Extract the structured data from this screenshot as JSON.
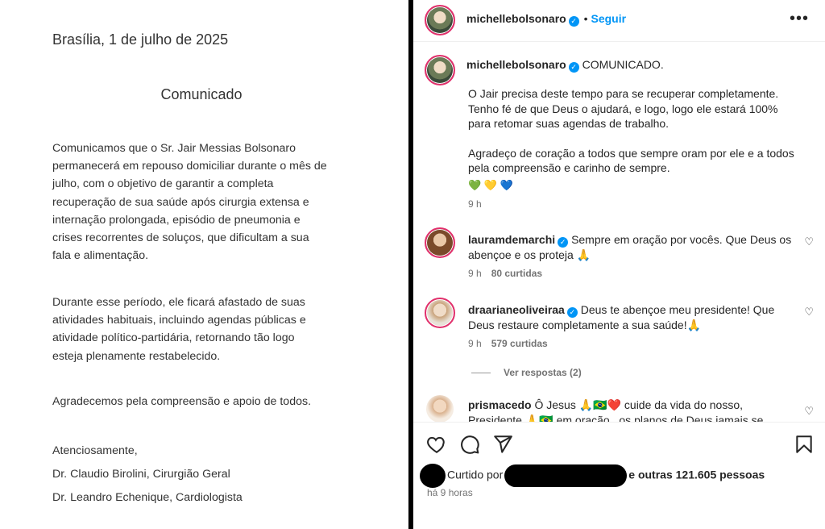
{
  "document": {
    "date": "Brasília, 1 de julho de 2025",
    "title": "Comunicado",
    "paragraph1": [
      "Comunicamos que o Sr. Jair Messias Bolsonaro",
      "permanecerá em repouso domiciliar durante o mês de",
      "julho, com o objetivo de garantir a completa",
      "recuperação de sua saúde após cirurgia extensa e",
      "internação prolongada, episódio de pneumonia e",
      "crises recorrentes de soluços, que dificultam a sua",
      "fala e alimentação."
    ],
    "paragraph2": [
      "Durante esse período, ele ficará afastado de suas",
      "atividades habituais, incluindo agendas públicas e",
      "atividade político-partidária, retornando tão logo",
      "esteja plenamente restabelecido."
    ],
    "paragraph3": [
      "Agradecemos pela compreensão e apoio de todos."
    ],
    "signature": [
      "Atenciosamente,",
      "Dr. Claudio Birolini, Cirurgião Geral",
      "Dr. Leandro Echenique, Cardiologista"
    ]
  },
  "post": {
    "author": "michellebolsonaro",
    "follow_label": "Seguir",
    "more_icon": "•••",
    "caption_title": "COMUNICADO.",
    "caption_lines_1": [
      "O Jair precisa deste tempo para se recuperar completamente.",
      "Tenho fé de que Deus o ajudará, e logo, logo ele estará 100%",
      "para retomar suas agendas de trabalho."
    ],
    "caption_lines_2": [
      "Agradeço de coração a todos que sempre oram por ele e a todos",
      "pela compreensão e carinho de sempre."
    ],
    "hearts": [
      "💚",
      "💛",
      "💙"
    ],
    "caption_time": "9 h",
    "comments": [
      {
        "user": "lauramdemarchi",
        "text": "Sempre em oração por vocês. Que Deus os abençoe e os proteja 🙏",
        "time": "9 h",
        "likes": "80 curtidas"
      },
      {
        "user": "draarianeoliveiraa",
        "text": "Deus te abençoe meu presidente! Que Deus restaure completamente a sua saúde!🙏",
        "time": "9 h",
        "likes": "579 curtidas"
      },
      {
        "user": "prismacedo",
        "text": "Ô Jesus 🙏🇧🇷❤️ cuide da vida do nosso, Presidente 🙏🇧🇷 em oração , os planos de Deus jamais se"
      }
    ],
    "view_replies": "Ver respostas (2)",
    "liked_by_prefix": "Curtido por",
    "liked_by_suffix": "e outras 121.605 pessoas",
    "post_time": "há 9 horas"
  }
}
